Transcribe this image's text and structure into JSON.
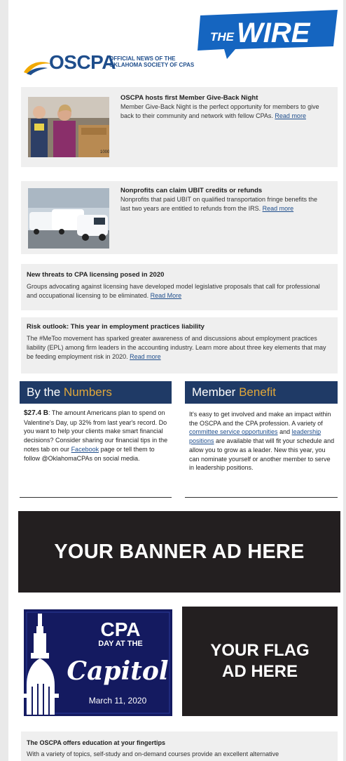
{
  "header": {
    "wire_the": "THE",
    "wire_word": "WIRE",
    "oscpa": "OSCPA",
    "tagline_line1": "OFFICIAL NEWS OF THE",
    "tagline_line2": "OKLAHOMA SOCIETY OF CPAs"
  },
  "articles": [
    {
      "title": "OSCPA hosts first Member Give-Back Night",
      "body": "Member Give-Back Night is the perfect opportunity for members to give back to their community and network with fellow CPAs. ",
      "link": "Read more"
    },
    {
      "title": "Nonprofits can claim UBIT credits or refunds",
      "body": "Nonprofits that paid UBIT on qualified transportation fringe benefits the last two years are entitled to refunds from the IRS. ",
      "link": "Read more"
    },
    {
      "title": "New threats to CPA licensing posed in 2020",
      "body": "Groups advocating against licensing have developed model legislative proposals that call for professional and occupational licensing to be eliminated. ",
      "link": "Read More"
    },
    {
      "title": "Risk outlook: This year in employment practices liability",
      "body": "The #MeToo movement has sparked greater awareness of and discussions about employment practices liability (EPL) among firm leaders in the accounting industry. Learn more about three key elements that may be feeding employment risk in 2020. ",
      "link": "Read more"
    }
  ],
  "numbers": {
    "heading_a": "By the ",
    "heading_b": "Numbers",
    "stat": "$27.4 B",
    "body_a": ": The amount Americans plan to spend on Valentine's Day, up 32% from last year's record.  Do you want to help your clients make smart financial decisions? Consider sharing our financial tips in the notes tab on our ",
    "facebook": "Facebook",
    "body_b": " page or tell them to follow @OklahomaCPAs on social media."
  },
  "benefit": {
    "heading_a": "Member ",
    "heading_b": "Benefit",
    "body_a": "It's easy to get involved and make an impact within the OSCPA and the CPA profession. A variety of ",
    "link1": "committee service opportunities",
    "body_b": " and ",
    "link2": "leadership positions",
    "body_c": " are available that will fit your schedule and allow you to grow as a leader. New this year, you can nominate yourself or another member to serve in leadership positions."
  },
  "banner": {
    "text": "YOUR BANNER AD HERE"
  },
  "capitol": {
    "cpa": "CPA",
    "day": "DAY AT THE",
    "capitol": "Capitol",
    "date": "March 11, 2020"
  },
  "flag": {
    "line1": "YOUR FLAG",
    "line2": "AD HERE"
  },
  "education": {
    "title": "The OSCPA offers education at your fingertips",
    "body": "With a variety of topics, self-study and on-demand courses provide an excellent alternative"
  },
  "colors": {
    "navy": "#1f3a66",
    "gold": "#e0a73a",
    "brand_blue": "#1f4e8c",
    "ad_dark": "#231f20"
  }
}
